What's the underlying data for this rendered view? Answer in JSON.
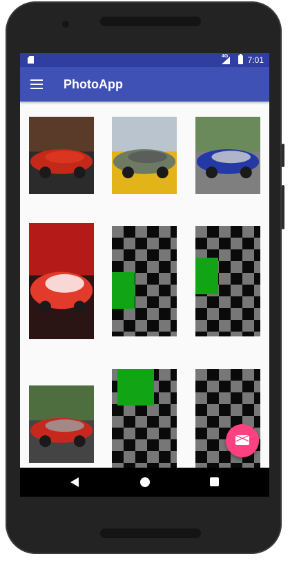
{
  "status_bar": {
    "time": "7:01",
    "network": "4G"
  },
  "app_bar": {
    "title": "PhotoApp",
    "menu_icon": "menu-icon"
  },
  "photos": [
    {
      "kind": "photo",
      "name": "red-ferrari-photo",
      "colors": [
        "#5a3b2a",
        "#c42818",
        "#e03a22",
        "#2b2b2b"
      ]
    },
    {
      "kind": "photo",
      "name": "road-photo",
      "colors": [
        "#b9c4cf",
        "#6f7a62",
        "#56595a",
        "#e3b31a"
      ]
    },
    {
      "kind": "photo",
      "name": "blue-racecar-photo",
      "colors": [
        "#6b8a5c",
        "#2539a6",
        "#d3d3d3",
        "#7f7f7f"
      ]
    },
    {
      "kind": "photo",
      "name": "formula-one-photo",
      "colors": [
        "#b31a18",
        "#e23b2b",
        "#ffffff",
        "#2a1414"
      ]
    },
    {
      "kind": "placeholder",
      "name": "checkered-placeholder-1",
      "green_color": "#11a516"
    },
    {
      "kind": "placeholder",
      "name": "checkered-placeholder-2",
      "green_color": "#11a516"
    },
    {
      "kind": "photo",
      "name": "red-truck-photo",
      "colors": [
        "#4e6e3f",
        "#c7281e",
        "#9aa0a0",
        "#444"
      ]
    },
    {
      "kind": "placeholder",
      "name": "checkered-placeholder-3",
      "green_color": "#11a516"
    },
    {
      "kind": "placeholder",
      "name": "checkered-placeholder-4",
      "green_color": "#11a516"
    }
  ],
  "fab": {
    "icon": "mail-icon",
    "color": "#ff4081"
  },
  "navigation": {
    "back_icon": "back-icon",
    "home_icon": "home-icon",
    "recents_icon": "recents-icon"
  },
  "theme": {
    "primary": "#3f51b5",
    "primary_dark": "#303f9f",
    "accent": "#ff4081"
  }
}
